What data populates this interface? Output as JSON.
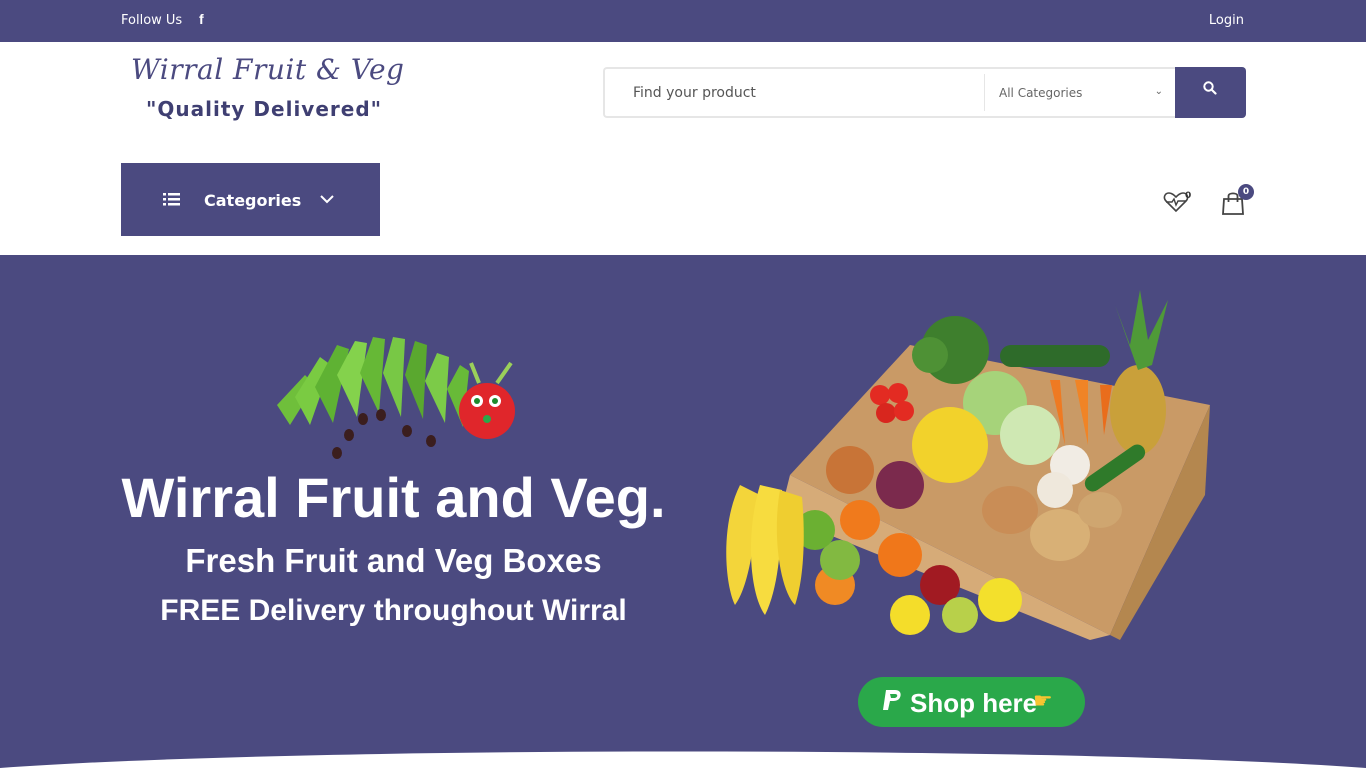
{
  "topbar": {
    "follow_label": "Follow Us",
    "facebook_icon": "f",
    "login_label": "Login"
  },
  "logo": {
    "title": "Wirral Fruit & Veg",
    "tagline": "\"Quality Delivered\""
  },
  "search": {
    "placeholder": "Find your product",
    "category_selected": "All Categories",
    "category_chevron": "⌄"
  },
  "nav": {
    "categories_label": "Categories"
  },
  "wishlist": {
    "count": "0"
  },
  "cart": {
    "count": "0"
  },
  "hero": {
    "title": "Wirral Fruit and Veg.",
    "subtitle": "Fresh Fruit and Veg Boxes",
    "subtitle2": "FREE Delivery throughout Wirral",
    "shop_button_label": "Shop here",
    "shop_hand_icon": "☛"
  },
  "colors": {
    "brand": "#4b4a80",
    "shop_button": "#2aa84a",
    "white": "#ffffff"
  }
}
